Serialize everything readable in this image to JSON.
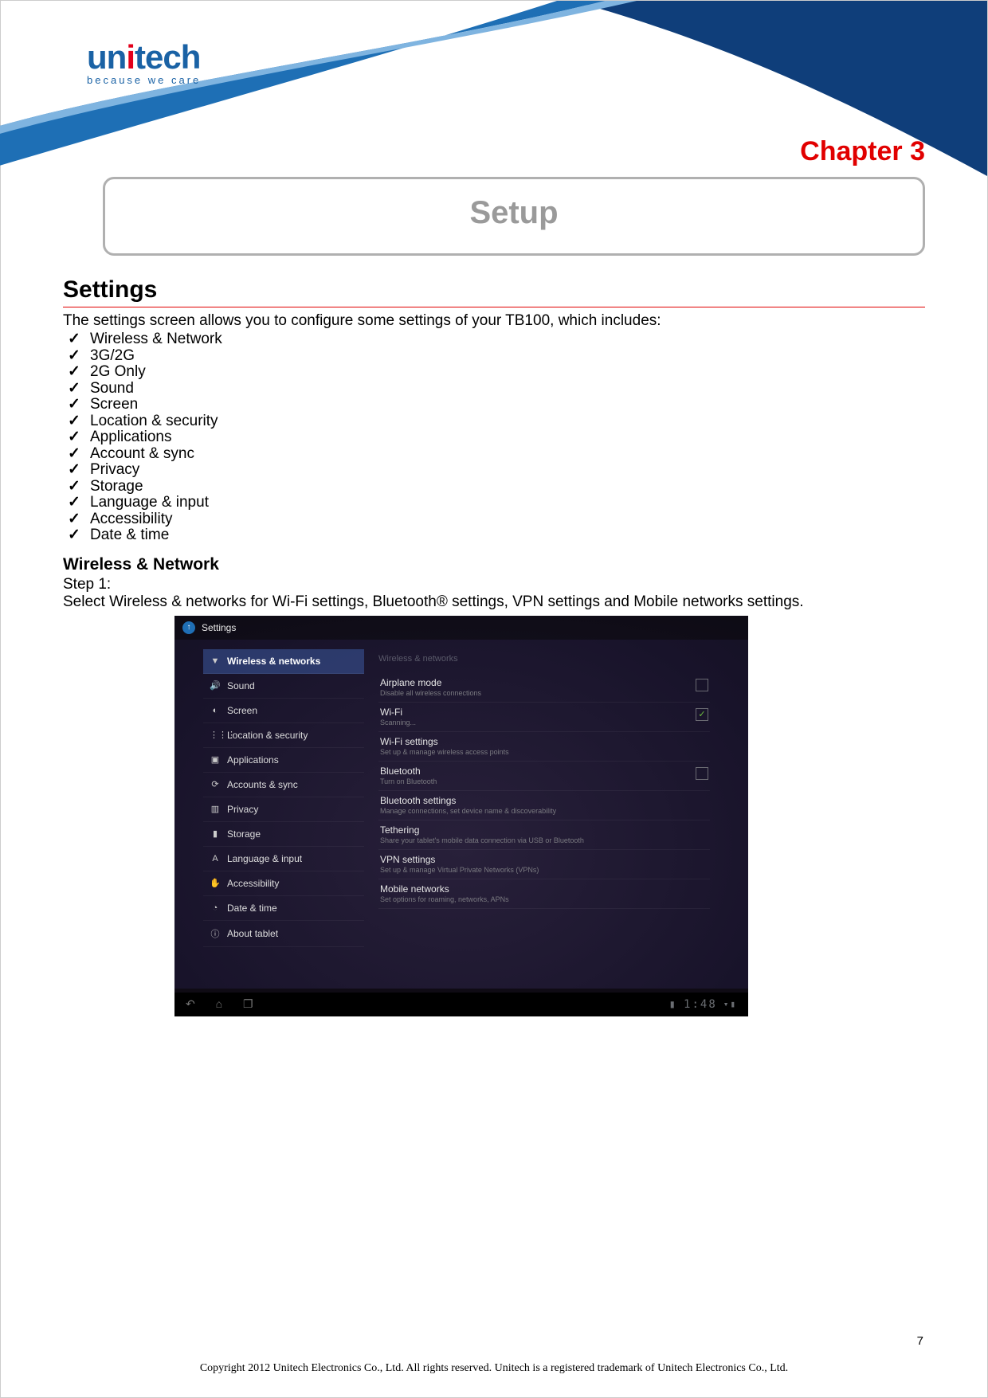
{
  "logo": {
    "brand": "unitech",
    "tag": "because we care"
  },
  "chapter": "Chapter  3",
  "setup": "Setup",
  "section": "Settings",
  "intro": "The settings screen allows you to configure some settings of your TB100, which includes:",
  "checks": [
    "Wireless & Network",
    "3G/2G",
    "2G Only",
    "Sound",
    "Screen",
    "Location & security",
    "Applications",
    "Account & sync",
    "Privacy",
    "Storage",
    "Language & input",
    "Accessibility",
    "Date & time"
  ],
  "subsection": "Wireless & Network",
  "step_label": "Step 1:",
  "step_text": "Select Wireless & networks for Wi-Fi settings, Bluetooth® settings, VPN settings and Mobile networks settings.",
  "shot": {
    "title": "Settings",
    "sidebar": [
      "Wireless & networks",
      "Sound",
      "Screen",
      "Location & security",
      "Applications",
      "Accounts & sync",
      "Privacy",
      "Storage",
      "Language & input",
      "Accessibility",
      "Date & time",
      "About tablet"
    ],
    "pane_title": "Wireless & networks",
    "rows": [
      {
        "title": "Airplane mode",
        "sub": "Disable all wireless connections",
        "chk": "empty"
      },
      {
        "title": "Wi-Fi",
        "sub": "Scanning...",
        "chk": "checked"
      },
      {
        "title": "Wi-Fi settings",
        "sub": "Set up & manage wireless access points"
      },
      {
        "title": "Bluetooth",
        "sub": "Turn on Bluetooth",
        "chk": "empty"
      },
      {
        "title": "Bluetooth settings",
        "sub": "Manage connections, set device name & discoverability"
      },
      {
        "title": "Tethering",
        "sub": "Share your tablet's mobile data connection via USB or Bluetooth"
      },
      {
        "title": "VPN settings",
        "sub": "Set up & manage Virtual Private Networks (VPNs)"
      },
      {
        "title": "Mobile networks",
        "sub": "Set options for roaming, networks, APNs"
      }
    ],
    "clock": "1:48"
  },
  "page_num": "7",
  "copyright": "Copyright 2012 Unitech Electronics Co., Ltd. All rights reserved. Unitech is a registered trademark of Unitech Electronics Co., Ltd."
}
